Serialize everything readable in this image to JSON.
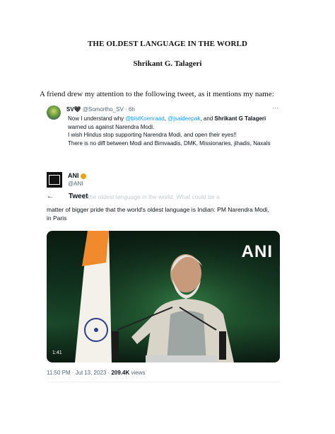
{
  "document": {
    "title": "THE OLDEST LANGUAGE IN THE WORLD",
    "author": "Shrikant G. Talageri",
    "intro": "A friend drew my attention to the following tweet, as it mentions my name:"
  },
  "tweet1": {
    "name": "SV🖤",
    "handle": "@Somortho_SV",
    "time": "· 6h",
    "more": "···",
    "line1_pre": "Now I understand why ",
    "mention1": "@blstKoenraad",
    "comma": ", ",
    "mention2": "@jsaideepak",
    "line1_mid": ", and ",
    "bold_name": "Shrikant G Talageri",
    "line1_post": " warned us against Narendra Modi.",
    "line2": "I wish Hindus stop supporting Narendra Modi, and open their eyes!!",
    "line3": "There is no diff between Modi and Bimvaadis, DMK, Missionaries, jihadis, Naxals"
  },
  "tweet2": {
    "name": "ANI",
    "handle": "@ANI",
    "back_icon": "←",
    "header_title": "Tweet",
    "ghost_text": "is the oldest language in the world. What could be a",
    "body": "matter of bigger pride that the world's oldest language is Indian: PM Narendra Modi, in Paris",
    "video_logo": "ANI",
    "video_duration": "1:41",
    "timestamp": "11:50 PM · Jul 13, 2023 · ",
    "views_count": "209.4K",
    "views_label": " views"
  },
  "colors": {
    "link": "#1d9bf0",
    "muted": "#536471",
    "verified": "#e8a317"
  },
  "icons": {
    "back": "arrow-left-icon",
    "more": "more-dots-icon",
    "verified": "verified-badge-icon"
  }
}
